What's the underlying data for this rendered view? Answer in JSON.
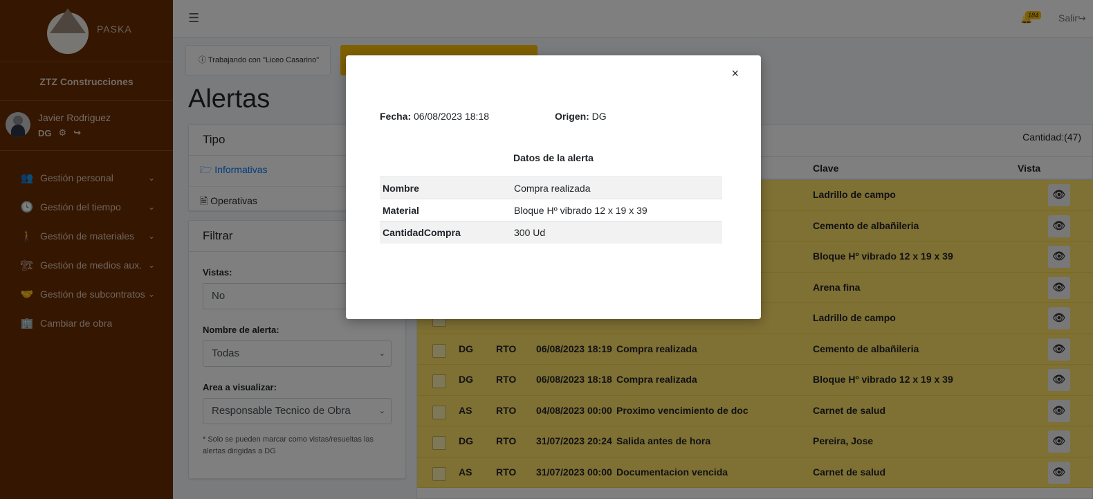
{
  "brand": {
    "logo_text": "PASKA",
    "company": "ZTZ Construcciones"
  },
  "user": {
    "name": "Javier Rodriguez",
    "role": "DG"
  },
  "nav": [
    {
      "label": "Gestión personal",
      "icon": "users-icon",
      "glyph": "👥",
      "chevron": true
    },
    {
      "label": "Gestión del tiempo",
      "icon": "clock-icon",
      "glyph": "🕓",
      "chevron": true
    },
    {
      "label": "Gestión de materiales",
      "icon": "person-carry-icon",
      "glyph": "🚶",
      "chevron": true
    },
    {
      "label": "Gestión de medios aux.",
      "icon": "crane-icon",
      "glyph": "🏗",
      "chevron": true
    },
    {
      "label": "Gestión de subcontratos",
      "icon": "handshake-icon",
      "glyph": "🤝",
      "chevron": true
    },
    {
      "label": "Cambiar de obra",
      "icon": "building-icon",
      "glyph": "🏢",
      "chevron": false
    }
  ],
  "topbar": {
    "notifications": "184",
    "logout": "Salir"
  },
  "working": "Trabajando con \"Liceo Casarino\"",
  "page_title": "Alertas",
  "tipo": {
    "title": "Tipo",
    "items": [
      "Informativas",
      "Operativas"
    ]
  },
  "filtrar": {
    "title": "Filtrar",
    "vistas_label": "Vistas:",
    "vistas_value": "No",
    "nombre_label": "Nombre de alerta:",
    "nombre_value": "Todas",
    "area_label": "Area a visualizar:",
    "area_value": "Responsable Tecnico de Obra",
    "note": "* Solo se pueden marcar como vistas/resueltas las alertas dirigidas a DG"
  },
  "table": {
    "cantidad": "Cantidad:(47)",
    "headers": {
      "clave": "Clave",
      "vista": "Vista"
    },
    "rows": [
      {
        "origen": "",
        "area": "",
        "fecha": "",
        "nombre": "",
        "clave": "Ladrillo de campo"
      },
      {
        "origen": "",
        "area": "",
        "fecha": "",
        "nombre": "",
        "clave": "Cemento de albañileria"
      },
      {
        "origen": "",
        "area": "",
        "fecha": "",
        "nombre": "",
        "clave": "Bloque Hº vibrado 12 x 19 x 39"
      },
      {
        "origen": "",
        "area": "",
        "fecha": "",
        "nombre": "",
        "clave": "Arena fina"
      },
      {
        "origen": "",
        "area": "",
        "fecha": "",
        "nombre": "",
        "clave": "Ladrillo de campo"
      },
      {
        "origen": "DG",
        "area": "RTO",
        "fecha": "06/08/2023 18:19",
        "nombre": "Compra realizada",
        "clave": "Cemento de albañileria"
      },
      {
        "origen": "DG",
        "area": "RTO",
        "fecha": "06/08/2023 18:18",
        "nombre": "Compra realizada",
        "clave": "Bloque Hº vibrado 12 x 19 x 39"
      },
      {
        "origen": "AS",
        "area": "RTO",
        "fecha": "04/08/2023 00:00",
        "nombre": "Proximo vencimiento de doc",
        "clave": "Carnet de salud"
      },
      {
        "origen": "DG",
        "area": "RTO",
        "fecha": "31/07/2023 20:24",
        "nombre": "Salida antes de hora",
        "clave": "Pereira, Jose"
      },
      {
        "origen": "AS",
        "area": "RTO",
        "fecha": "31/07/2023 00:00",
        "nombre": "Documentacion vencida",
        "clave": "Carnet de salud"
      }
    ]
  },
  "modal": {
    "fecha_label": "Fecha:",
    "fecha_value": "06/08/2023 18:18",
    "origen_label": "Origen:",
    "origen_value": "DG",
    "section_title": "Datos de la alerta",
    "fields": [
      {
        "key": "Nombre",
        "value": "Compra realizada"
      },
      {
        "key": "Material",
        "value": "Bloque Hº vibrado 12 x 19 x 39"
      },
      {
        "key": "CantidadCompra",
        "value": "300 Ud"
      }
    ],
    "close": "×"
  }
}
